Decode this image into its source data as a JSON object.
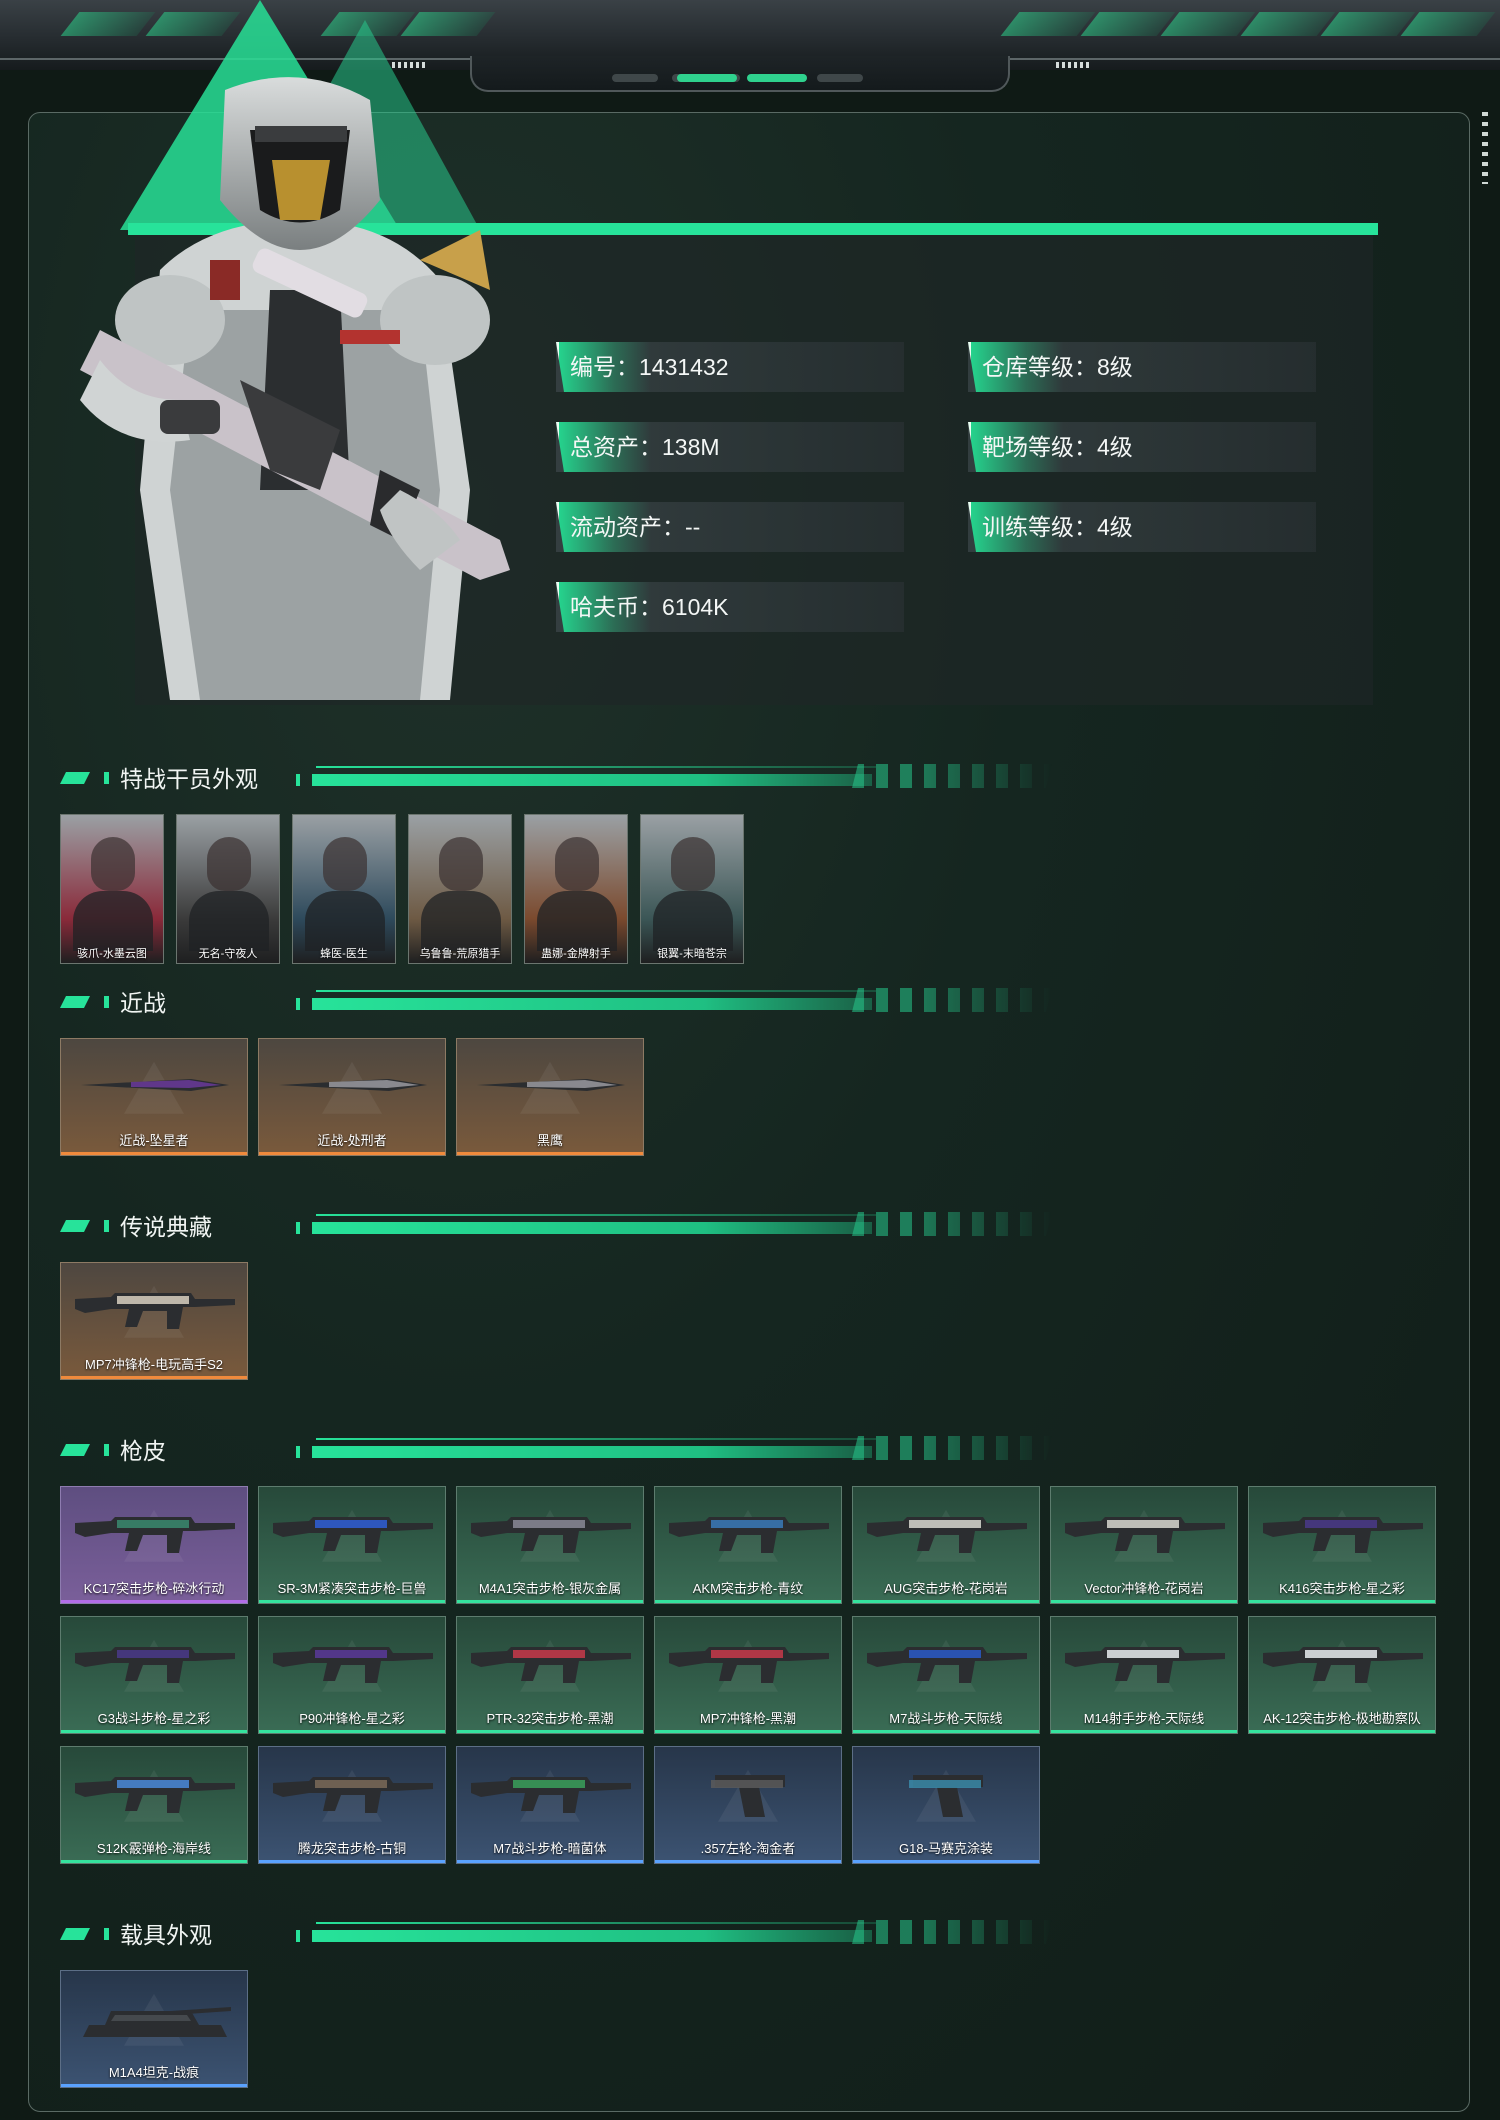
{
  "stats": [
    {
      "label": "编号",
      "value": "1431432"
    },
    {
      "label": "仓库等级",
      "value": "8级"
    },
    {
      "label": "总资产",
      "value": "138M"
    },
    {
      "label": "靶场等级",
      "value": "4级"
    },
    {
      "label": "流动资产",
      "value": "--"
    },
    {
      "label": "训练等级",
      "value": "4级"
    },
    {
      "label": "哈夫币",
      "value": "6104K"
    }
  ],
  "sections": {
    "operators": "特战干员外观",
    "melee": "近战",
    "legendary": "传说典藏",
    "skins": "枪皮",
    "vehicles": "载具外观"
  },
  "operators": [
    {
      "label": "骇爪-水墨云图",
      "color": "#8a2a3a"
    },
    {
      "label": "无名-守夜人",
      "color": "#3b3b3b"
    },
    {
      "label": "蜂医-医生",
      "color": "#2e4a5c"
    },
    {
      "label": "乌鲁鲁-荒原猎手",
      "color": "#6e5a44"
    },
    {
      "label": "蛊娜-金牌射手",
      "color": "#7b4a2e"
    },
    {
      "label": "银翼-末暗苍宗",
      "color": "#3b5656"
    }
  ],
  "melee": [
    {
      "label": "近战-坠星者"
    },
    {
      "label": "近战-处刑者"
    },
    {
      "label": "黑鹰"
    }
  ],
  "legendary": [
    {
      "label": "MP7冲锋枪-电玩高手S2"
    }
  ],
  "skins": [
    {
      "label": "KC17突击步枪-碎冰行动",
      "rarity": "purple",
      "accent": "#3a8a6e"
    },
    {
      "label": "SR-3M紧凑突击步枪-巨兽",
      "rarity": "green",
      "accent": "#2f5fd6"
    },
    {
      "label": "M4A1突击步枪-银灰金属",
      "rarity": "green",
      "accent": "#8a8a96"
    },
    {
      "label": "AKM突击步枪-青纹",
      "rarity": "green",
      "accent": "#3a7ab8"
    },
    {
      "label": "AUG突击步枪-花岗岩",
      "rarity": "green",
      "accent": "#d8d8d0"
    },
    {
      "label": "Vector冲锋枪-花岗岩",
      "rarity": "green",
      "accent": "#d8d8d0"
    },
    {
      "label": "K416突击步枪-星之彩",
      "rarity": "green",
      "accent": "#4a3a8a"
    },
    {
      "label": "G3战斗步枪-星之彩",
      "rarity": "green",
      "accent": "#4a3a8a"
    },
    {
      "label": "P90冲锋枪-星之彩",
      "rarity": "green",
      "accent": "#5a3a9a"
    },
    {
      "label": "PTR-32突击步枪-黑潮",
      "rarity": "green",
      "accent": "#c83a4a"
    },
    {
      "label": "MP7冲锋枪-黑潮",
      "rarity": "green",
      "accent": "#c83a4a"
    },
    {
      "label": "M7战斗步枪-天际线",
      "rarity": "green",
      "accent": "#2a5ac8"
    },
    {
      "label": "M14射手步枪-天际线",
      "rarity": "green",
      "accent": "#e8ecef"
    },
    {
      "label": "AK-12突击步枪-极地勘察队",
      "rarity": "green",
      "accent": "#e8ecef"
    },
    {
      "label": "S12K霰弹枪-海岸线",
      "rarity": "green",
      "accent": "#4a8ad8"
    },
    {
      "label": "腾龙突击步枪-古铜",
      "rarity": "blue",
      "accent": "#7a6a58"
    },
    {
      "label": "M7战斗步枪-暗菌体",
      "rarity": "blue",
      "accent": "#3aa05a"
    },
    {
      ".label": "",
      "label": ".357左轮-淘金者",
      "rarity": "blue",
      "accent": "#5a5a5a"
    },
    {
      "label": "G18-马赛克涂装",
      "rarity": "blue",
      "accent": "#3a8aa8"
    }
  ],
  "vehicles": [
    {
      "label": "M1A4坦克-战痕"
    }
  ],
  "icons": {
    "soldier": "operator-portrait",
    "rifle": "rifle-icon"
  },
  "colors": {
    "accent": "#27e39a",
    "panel": "#152620",
    "melee_underline": "#f08a3c",
    "purple_underline": "#b26de8",
    "green_underline": "#35e39e",
    "blue_underline": "#5aa2ff"
  }
}
